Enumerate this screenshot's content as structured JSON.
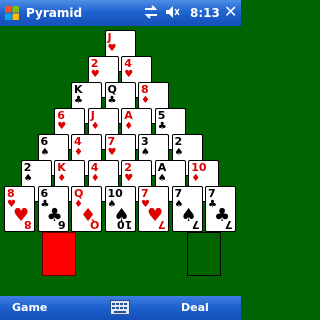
{
  "window": {
    "title": "Pyramid",
    "time": "8:13"
  },
  "menu": {
    "left": "Game",
    "right": "Deal"
  },
  "colors": {
    "felt": "#006400",
    "bar": "#1d5fcc",
    "card_back": "#ff0000"
  },
  "pyramid": [
    [
      {
        "rank": "J",
        "suit": "♥"
      }
    ],
    [
      {
        "rank": "2",
        "suit": "♥"
      },
      {
        "rank": "4",
        "suit": "♥"
      }
    ],
    [
      {
        "rank": "K",
        "suit": "♣"
      },
      {
        "rank": "Q",
        "suit": "♣"
      },
      {
        "rank": "8",
        "suit": "♦"
      }
    ],
    [
      {
        "rank": "6",
        "suit": "♥"
      },
      {
        "rank": "J",
        "suit": "♦"
      },
      {
        "rank": "A",
        "suit": "♦"
      },
      {
        "rank": "5",
        "suit": "♣"
      }
    ],
    [
      {
        "rank": "6",
        "suit": "♠"
      },
      {
        "rank": "4",
        "suit": "♦"
      },
      {
        "rank": "7",
        "suit": "♥"
      },
      {
        "rank": "3",
        "suit": "♠"
      },
      {
        "rank": "2",
        "suit": "♠"
      }
    ],
    [
      {
        "rank": "2",
        "suit": "♠"
      },
      {
        "rank": "K",
        "suit": "♦"
      },
      {
        "rank": "4",
        "suit": "♦"
      },
      {
        "rank": "2",
        "suit": "♥"
      },
      {
        "rank": "A",
        "suit": "♠"
      },
      {
        "rank": "10",
        "suit": "♦"
      }
    ],
    [
      {
        "rank": "8",
        "suit": "♥"
      },
      {
        "rank": "6",
        "suit": "♣"
      },
      {
        "rank": "Q",
        "suit": "♦"
      },
      {
        "rank": "10",
        "suit": "♠"
      },
      {
        "rank": "7",
        "suit": "♥"
      },
      {
        "rank": "7",
        "suit": "♠"
      },
      {
        "rank": "7",
        "suit": "♣"
      }
    ]
  ],
  "stock": {
    "label": ""
  },
  "waste": {
    "label": ""
  }
}
